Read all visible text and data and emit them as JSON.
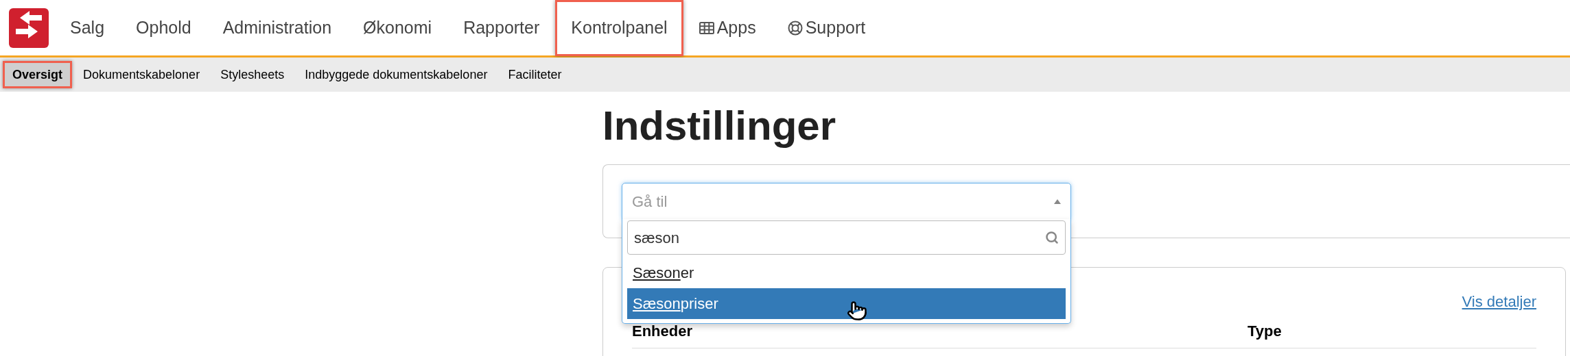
{
  "nav": [
    {
      "label": "Salg",
      "kind": "text",
      "highlighted": false
    },
    {
      "label": "Ophold",
      "kind": "text",
      "highlighted": false
    },
    {
      "label": "Administration",
      "kind": "text",
      "highlighted": false
    },
    {
      "label": "Økonomi",
      "kind": "text",
      "highlighted": false
    },
    {
      "label": "Rapporter",
      "kind": "text",
      "highlighted": false
    },
    {
      "label": "Kontrolpanel",
      "kind": "text",
      "highlighted": true
    },
    {
      "label": "Apps",
      "kind": "grid",
      "highlighted": false
    },
    {
      "label": "Support",
      "kind": "lifebuoy",
      "highlighted": false
    }
  ],
  "subnav": [
    {
      "label": "Oversigt",
      "selected": true,
      "highlighted": true
    },
    {
      "label": "Dokumentskabeloner",
      "selected": false,
      "highlighted": false
    },
    {
      "label": "Stylesheets",
      "selected": false,
      "highlighted": false
    },
    {
      "label": "Indbyggede dokumentskabeloner",
      "selected": false,
      "highlighted": false
    },
    {
      "label": "Faciliteter",
      "selected": false,
      "highlighted": false
    }
  ],
  "heading": "Indstillinger",
  "goto": {
    "placeholder": "Gå til",
    "expanded": true,
    "search": "sæson",
    "options": [
      {
        "match": "Sæson",
        "rest": "er",
        "selected": false
      },
      {
        "match": "Sæson",
        "rest": "priser",
        "selected": true
      }
    ]
  },
  "details_link": "Vis detaljer",
  "table": {
    "columns": [
      "Enheder",
      "Type"
    ]
  }
}
